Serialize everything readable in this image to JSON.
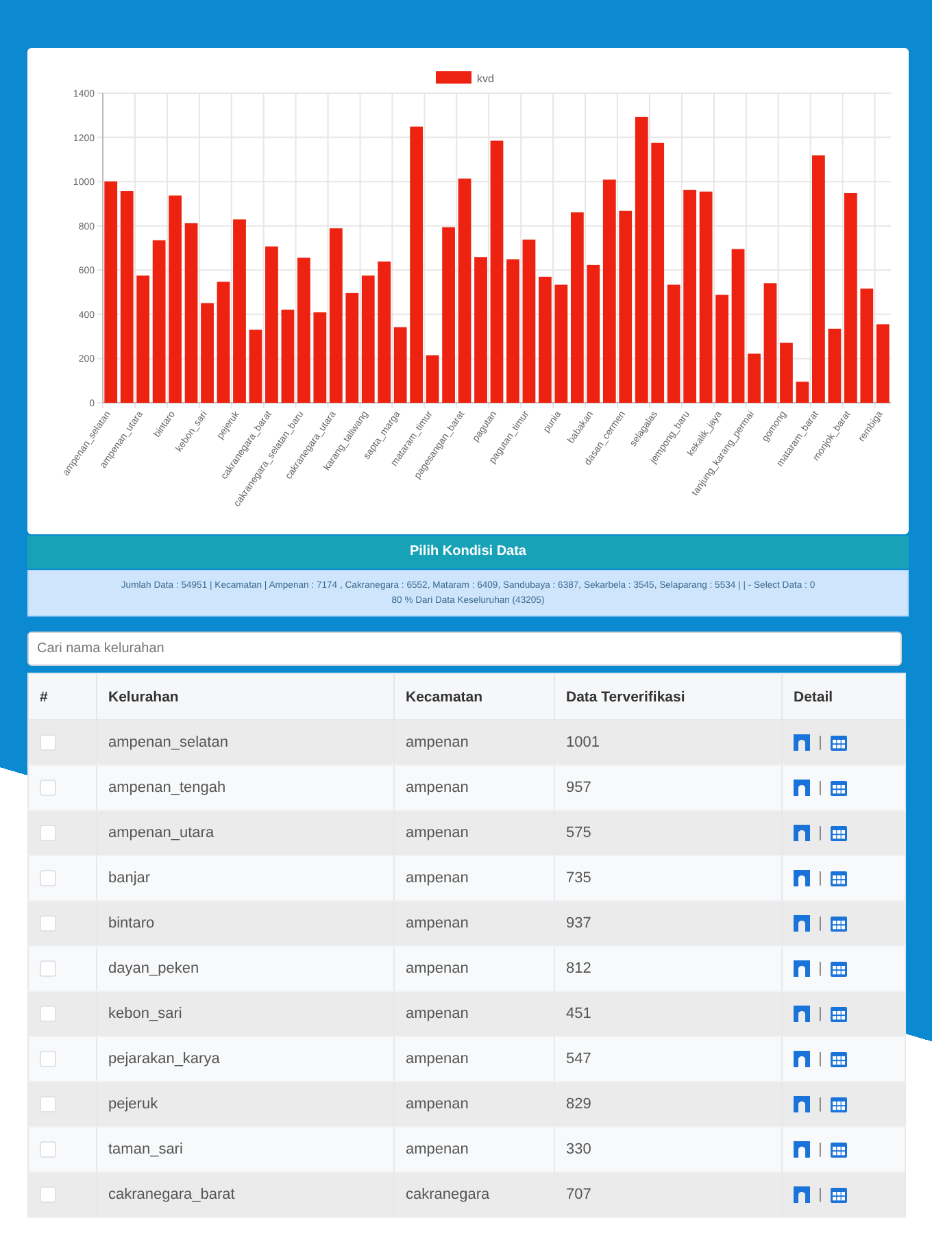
{
  "chart_card": {
    "chart_data": {
      "type": "bar",
      "grid": true,
      "series": [
        {
          "name": "kvd",
          "color": "#ee2211",
          "values": [
            1001,
            957,
            575,
            735,
            937,
            812,
            451,
            547,
            829,
            330,
            707,
            421,
            656,
            409,
            789,
            496,
            575,
            639,
            342,
            1249,
            215,
            794,
            1014,
            659,
            1185,
            649,
            738,
            570,
            534,
            861,
            623,
            1009,
            868,
            1292,
            1175,
            534,
            963,
            955,
            488,
            695,
            222,
            541,
            271,
            95,
            1119,
            335,
            948,
            516,
            355
          ]
        }
      ],
      "ylim": [
        0,
        1400
      ],
      "yticks": [
        0,
        200,
        400,
        600,
        800,
        1000,
        1200,
        1400
      ],
      "categories": [
        "ampenan_selatan",
        null,
        "ampenan_utara",
        null,
        "bintaro",
        null,
        "kebon_sari",
        null,
        "pejeruk",
        null,
        "cakranegara_barat",
        null,
        "cakranegara_selatan_baru",
        null,
        "cakranegara_utara",
        null,
        "karang_taliwang",
        null,
        "sapta_marga",
        null,
        "mataram_timur",
        null,
        "pagesangan_barat",
        null,
        "pagutan",
        null,
        "pagutan_timur",
        null,
        "punia",
        null,
        "babakan",
        null,
        "dasan_cermen",
        null,
        "selagalas",
        null,
        "jempong_baru",
        null,
        "kekalik_jaya",
        null,
        "tanjung_karang_permai",
        null,
        "gomong",
        null,
        "mataram_barat",
        null,
        "monjok_barat",
        null,
        "rembiga"
      ]
    }
  },
  "filter_panel": {
    "title": "Pilih Kondisi Data",
    "summary_lines": [
      "Jumlah Data : 54951 | Kecamatan | Ampenan : 7174 , Cakranegara : 6552, Mataram : 6409, Sandubaya : 6387, Sekarbela : 3545, Selaparang : 5534 | | - Select Data : 0",
      "80 % Dari Data Keseluruhan (43205)"
    ]
  },
  "search": {
    "placeholder": "Cari nama kelurahan"
  },
  "table": {
    "columns": [
      "#",
      "Kelurahan",
      "Kecamatan",
      "Data Terverifikasi",
      "Detail"
    ],
    "rows": [
      {
        "checked": false,
        "kelurahan": "ampenan_selatan",
        "kecamatan": "ampenan",
        "data_terverifikasi": "1001",
        "separator": "|"
      },
      {
        "checked": false,
        "kelurahan": "ampenan_tengah",
        "kecamatan": "ampenan",
        "data_terverifikasi": "957",
        "separator": "|"
      },
      {
        "checked": false,
        "kelurahan": "ampenan_utara",
        "kecamatan": "ampenan",
        "data_terverifikasi": "575",
        "separator": "|"
      },
      {
        "checked": false,
        "kelurahan": "banjar",
        "kecamatan": "ampenan",
        "data_terverifikasi": "735",
        "separator": "|"
      },
      {
        "checked": false,
        "kelurahan": "bintaro",
        "kecamatan": "ampenan",
        "data_terverifikasi": "937",
        "separator": "|"
      },
      {
        "checked": false,
        "kelurahan": "dayan_peken",
        "kecamatan": "ampenan",
        "data_terverifikasi": "812",
        "separator": "|"
      },
      {
        "checked": false,
        "kelurahan": "kebon_sari",
        "kecamatan": "ampenan",
        "data_terverifikasi": "451",
        "separator": "|"
      },
      {
        "checked": false,
        "kelurahan": "pejarakan_karya",
        "kecamatan": "ampenan",
        "data_terverifikasi": "547",
        "separator": "|"
      },
      {
        "checked": false,
        "kelurahan": "pejeruk",
        "kecamatan": "ampenan",
        "data_terverifikasi": "829",
        "separator": "|"
      },
      {
        "checked": false,
        "kelurahan": "taman_sari",
        "kecamatan": "ampenan",
        "data_terverifikasi": "330",
        "separator": "|"
      },
      {
        "checked": false,
        "kelurahan": "cakranegara_barat",
        "kecamatan": "cakranegara",
        "data_terverifikasi": "707",
        "separator": "|"
      }
    ]
  }
}
